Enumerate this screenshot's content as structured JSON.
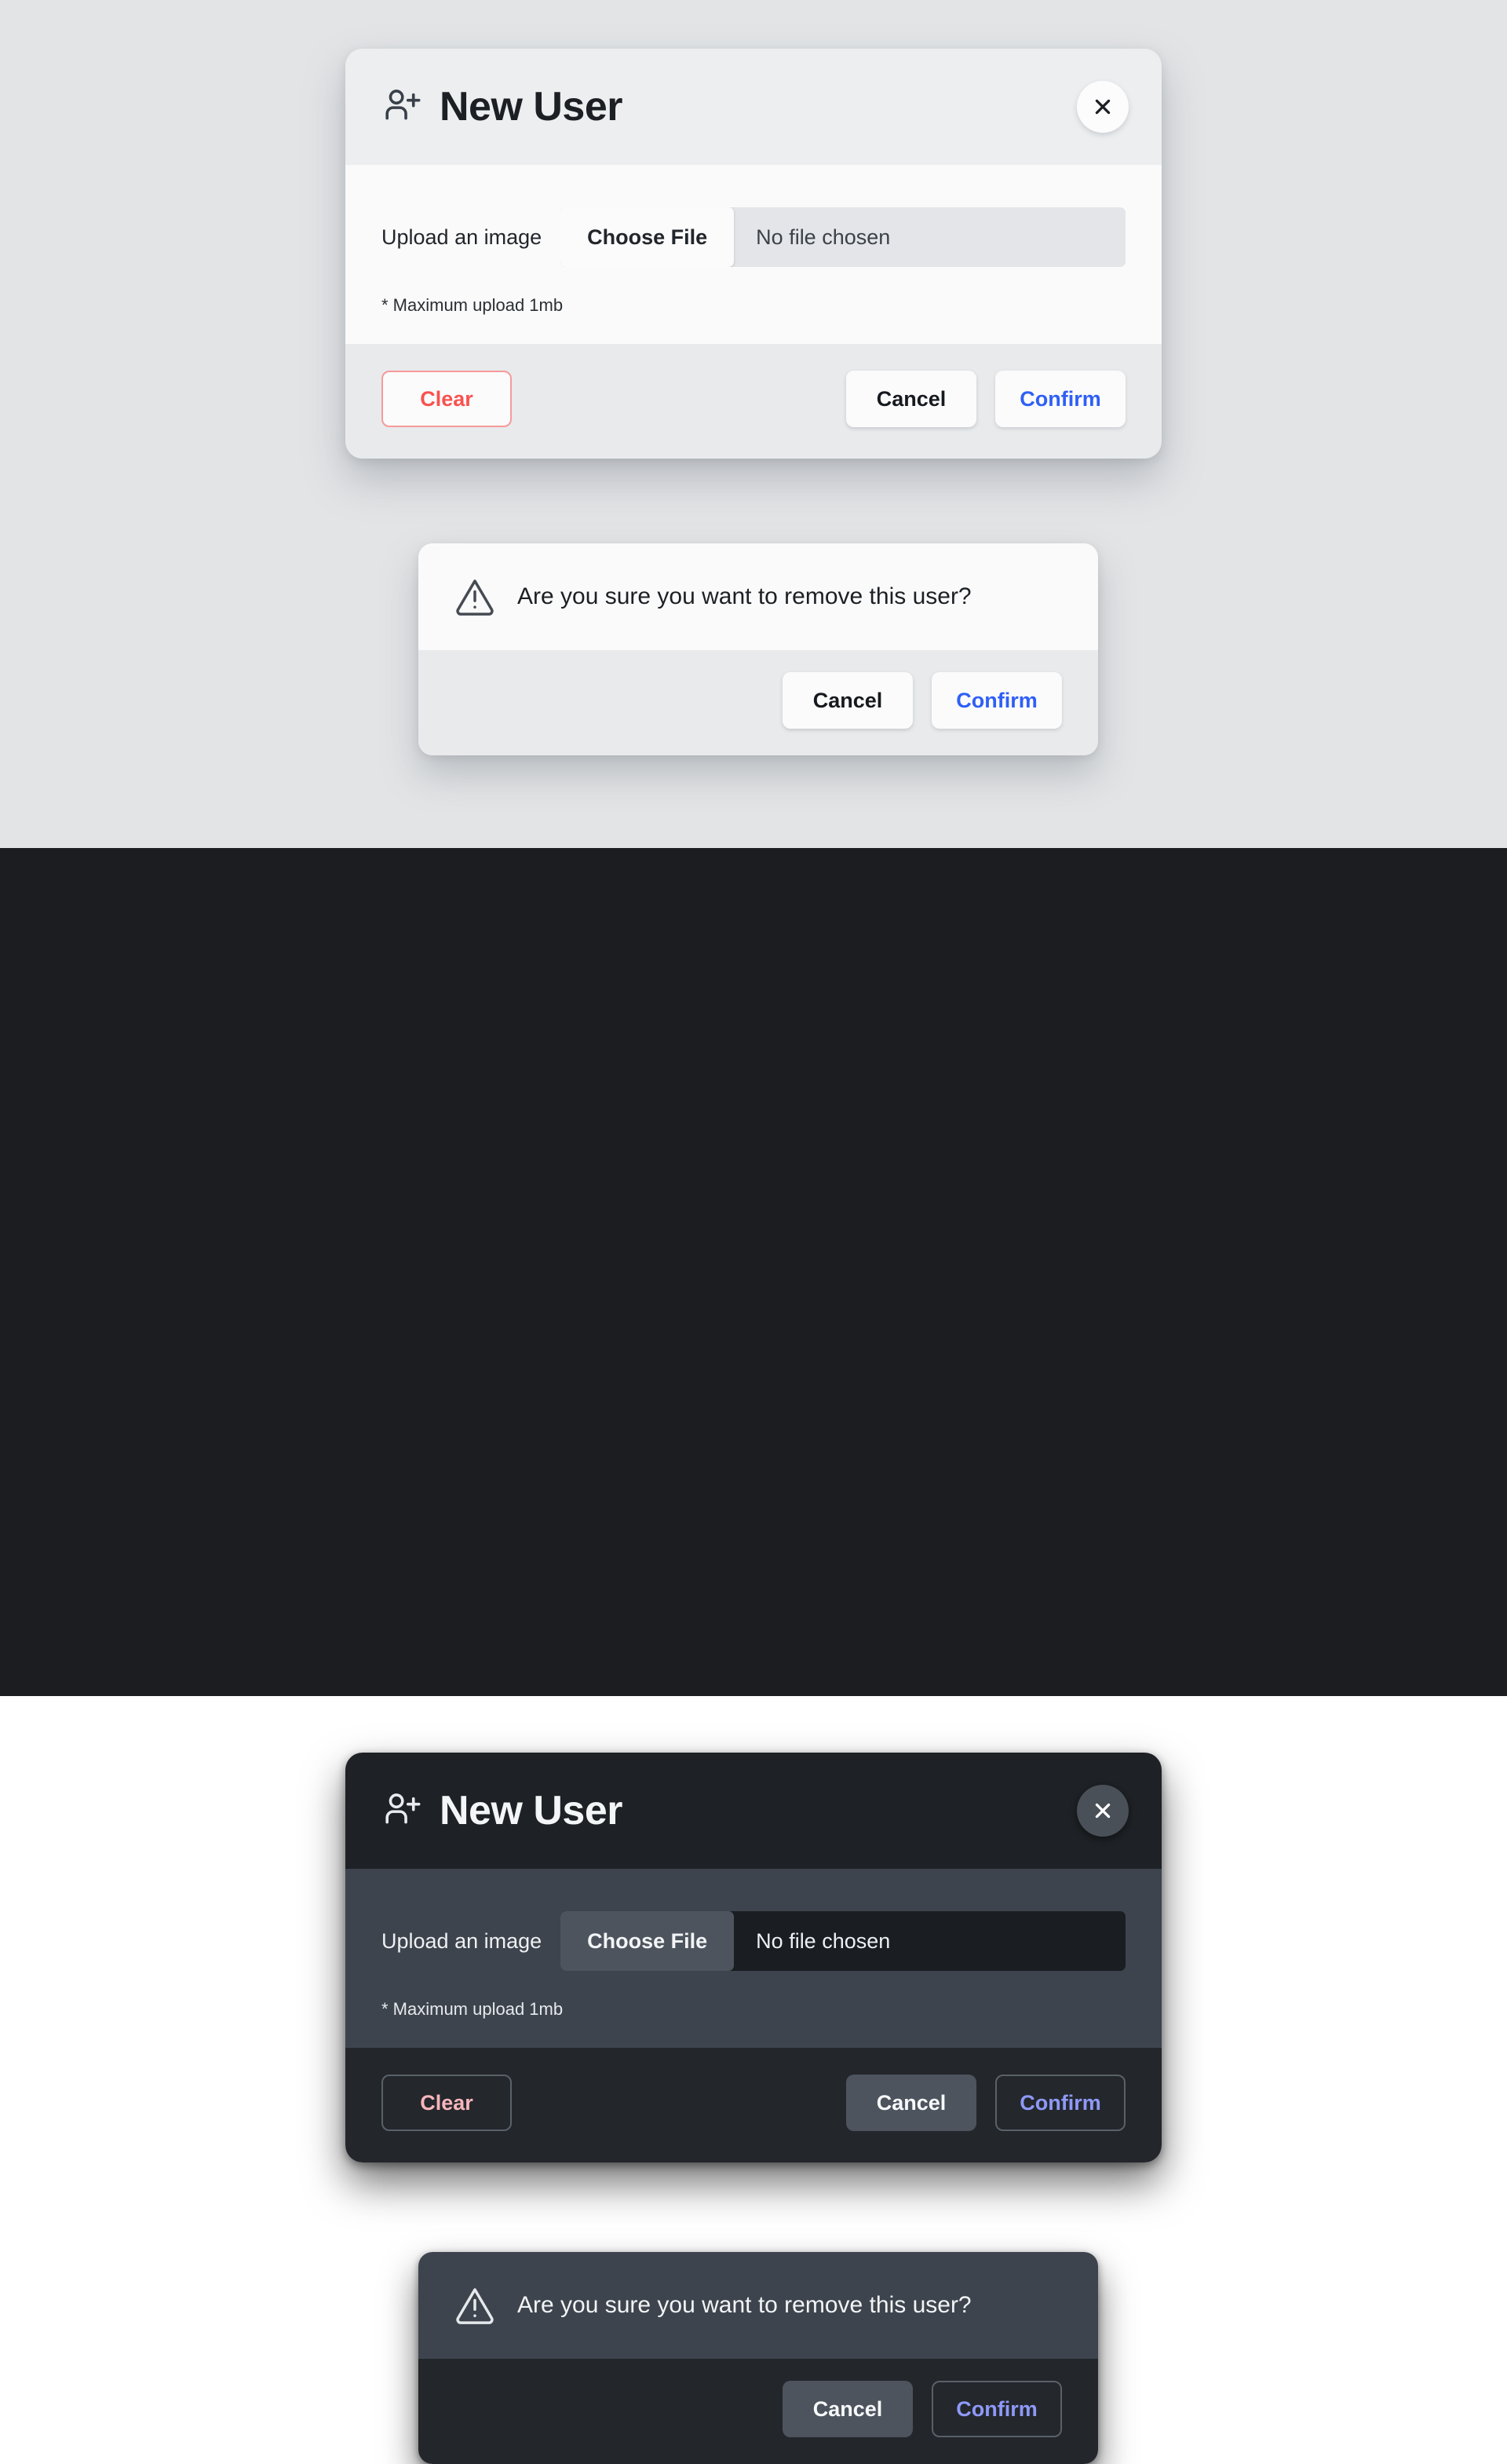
{
  "theme_colors": {
    "light_page_bg": "#e2e4e6",
    "dark_page_bg": "#1b1d21",
    "accent_blue": "#2f5ff5",
    "accent_blue_dark": "#8e99f7",
    "danger_red": "#f8524f",
    "danger_red_dark": "#f6b6bb"
  },
  "new_user_card": {
    "header": {
      "icon": "user-plus-icon",
      "title": "New User",
      "close_icon": "close-icon"
    },
    "body": {
      "upload_label": "Upload an image",
      "choose_file_label": "Choose File",
      "file_name": "No file chosen",
      "hint": "* Maximum upload 1mb"
    },
    "footer": {
      "clear_label": "Clear",
      "cancel_label": "Cancel",
      "confirm_label": "Confirm"
    }
  },
  "confirm_dialog": {
    "icon": "warning-triangle-icon",
    "message": "Are you sure you want to remove this user?",
    "cancel_label": "Cancel",
    "confirm_label": "Confirm"
  }
}
